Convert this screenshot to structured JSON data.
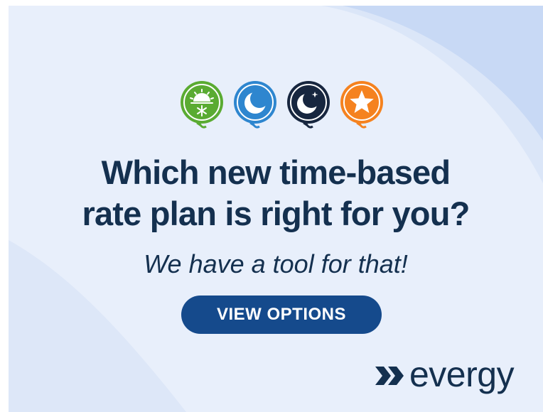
{
  "headline": {
    "line1": "Which new time-based",
    "line2": "rate plan is right for you?"
  },
  "subhead": "We have a tool for that!",
  "cta": {
    "label": "VIEW OPTIONS"
  },
  "brand": {
    "name": "evergy"
  },
  "plan_icons": [
    {
      "icon": "sun-snowflake-icon",
      "color": "#5aab32"
    },
    {
      "icon": "crescent-moon-icon",
      "color": "#2e86cf"
    },
    {
      "icon": "moon-star-icon",
      "color": "#17263f"
    },
    {
      "icon": "star-icon",
      "color": "#f5821f"
    }
  ],
  "colors": {
    "headline_text": "#14304f",
    "button_background": "#154a8c",
    "button_text": "#ffffff",
    "background_light": "#e6eefb",
    "background_accent": "#c9daf6"
  }
}
